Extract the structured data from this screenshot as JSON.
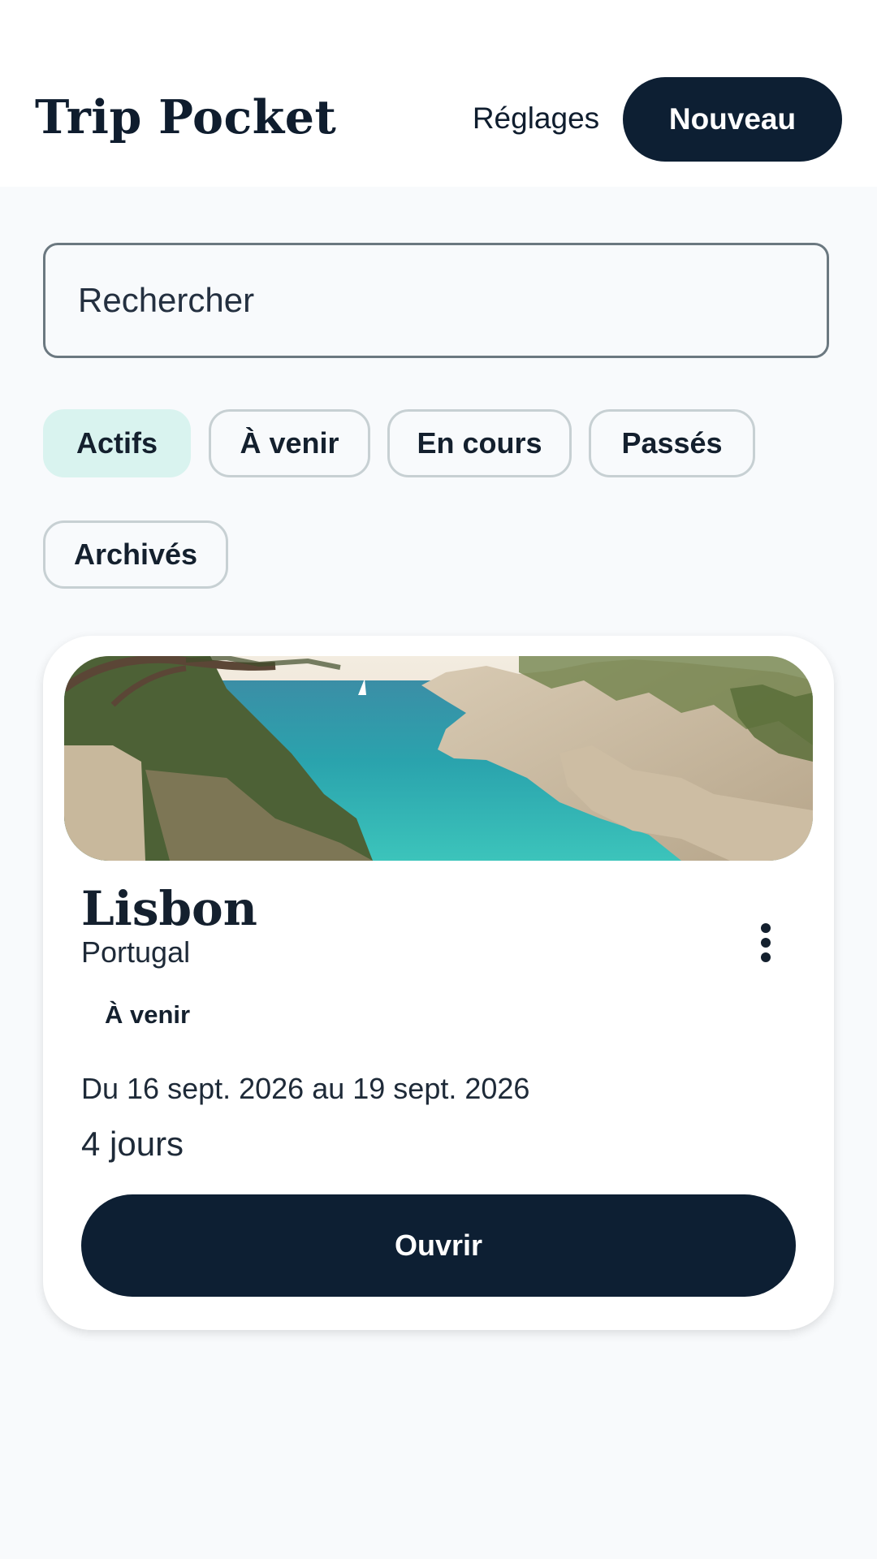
{
  "header": {
    "app_title": "Trip Pocket",
    "settings_label": "Réglages",
    "new_label": "Nouveau"
  },
  "search": {
    "placeholder": "Rechercher"
  },
  "filters": [
    {
      "label": "Actifs",
      "selected": true
    },
    {
      "label": "À venir",
      "selected": false
    },
    {
      "label": "En cours",
      "selected": false
    },
    {
      "label": "Passés",
      "selected": false
    },
    {
      "label": "Archivés",
      "selected": false
    }
  ],
  "trips": [
    {
      "city": "Lisbon",
      "country": "Portugal",
      "status": "À venir",
      "dates": "Du 16 sept. 2026 au 19 sept. 2026",
      "duration": "4 jours",
      "open_label": "Ouvrir",
      "menu_icon": "more-vertical-icon",
      "image": "coastal-cove-photo"
    }
  ],
  "colors": {
    "primary": "#0d1f33",
    "background": "#f8fafc",
    "chip_selected": "#d9f3ef",
    "chip_border": "#c7d0d3",
    "search_border": "#6b7880"
  }
}
